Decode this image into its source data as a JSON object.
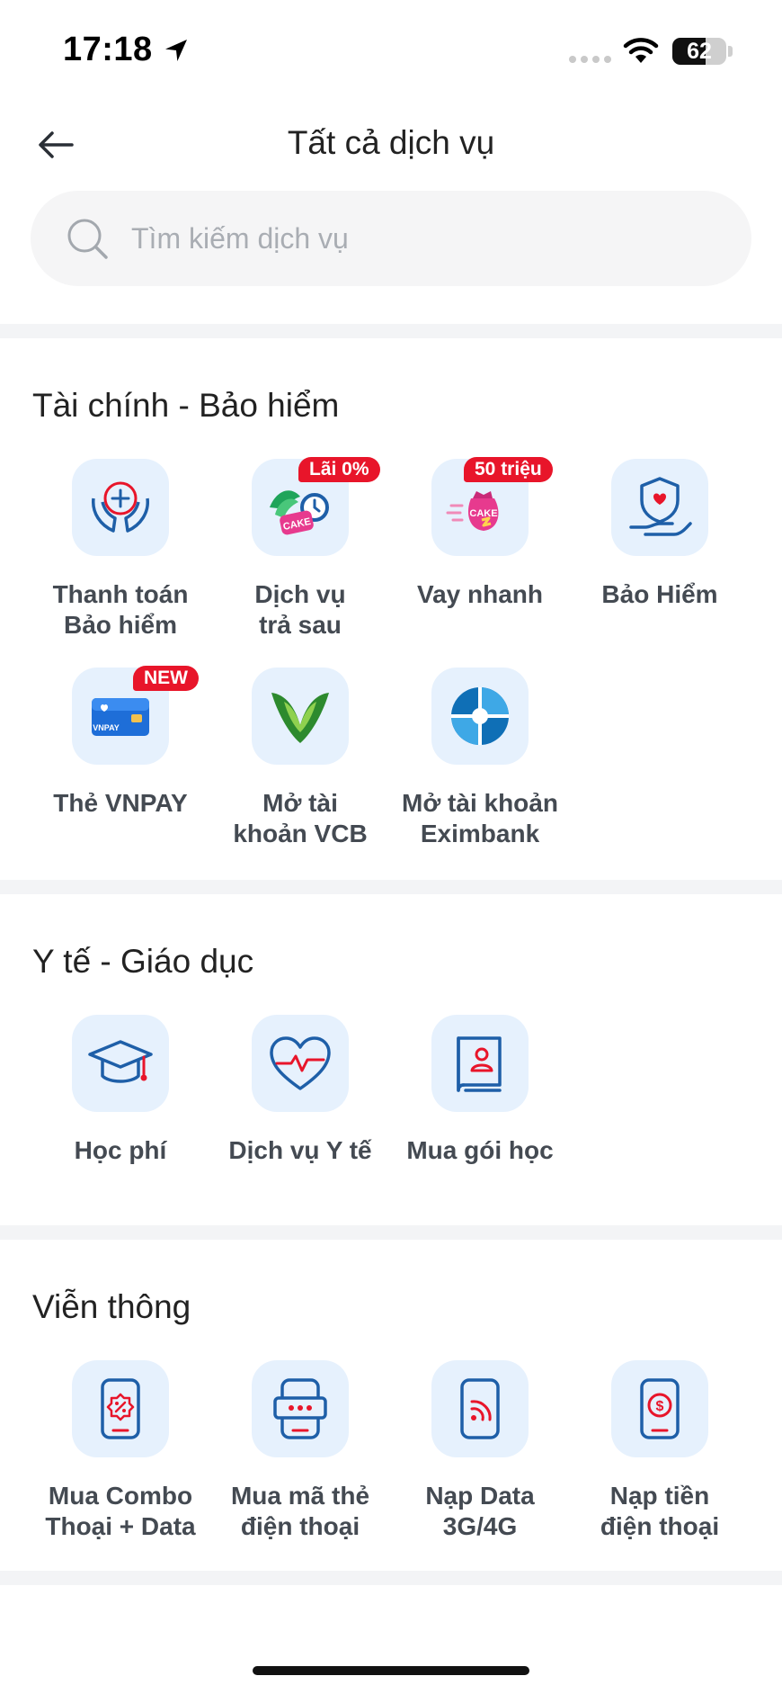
{
  "status_bar": {
    "time": "17:18",
    "battery": "62",
    "battery_level": 0.62
  },
  "header": {
    "title": "Tất cả dịch vụ"
  },
  "search": {
    "placeholder": "Tìm kiếm dịch vụ"
  },
  "sections": [
    {
      "title": "Tài chính - Bảo hiểm",
      "items": [
        {
          "label": "Thanh toán\nBảo hiểm",
          "icon": "hands-insurance-icon"
        },
        {
          "label": "Dịch vụ\ntrả sau",
          "icon": "cake-paylater-icon",
          "badge": "Lãi 0%"
        },
        {
          "label": "Vay nhanh",
          "icon": "cake-loan-icon",
          "badge": "50 triệu"
        },
        {
          "label": "Bảo Hiểm",
          "icon": "shield-hand-icon"
        },
        {
          "label": "Thẻ VNPAY",
          "icon": "vnpay-card-icon",
          "badge": "NEW",
          "card_text": "VNPAY"
        },
        {
          "label": "Mở tài\nkhoản VCB",
          "icon": "vcb-logo-icon"
        },
        {
          "label": "Mở tài khoản\nEximbank",
          "icon": "eximbank-logo-icon"
        }
      ]
    },
    {
      "title": "Y tế - Giáo dục",
      "items": [
        {
          "label": "Học phí",
          "icon": "graduation-cap-icon"
        },
        {
          "label": "Dịch vụ Y tế",
          "icon": "heart-pulse-icon"
        },
        {
          "label": "Mua gói học",
          "icon": "study-book-icon"
        }
      ]
    },
    {
      "title": "Viễn thông",
      "items": [
        {
          "label": "Mua Combo\nThoại + Data",
          "icon": "phone-combo-icon"
        },
        {
          "label": "Mua mã thẻ\nđiện thoại",
          "icon": "phone-card-icon"
        },
        {
          "label": "Nạp Data\n3G/4G",
          "icon": "phone-data-icon"
        },
        {
          "label": "Nạp tiền\nđiện thoại",
          "icon": "phone-topup-icon"
        }
      ]
    }
  ],
  "colors": {
    "accent": "#1e5fa8",
    "tile_bg": "#e6f1fd",
    "badge": "#e8152a",
    "divider": "#f3f4f6"
  }
}
